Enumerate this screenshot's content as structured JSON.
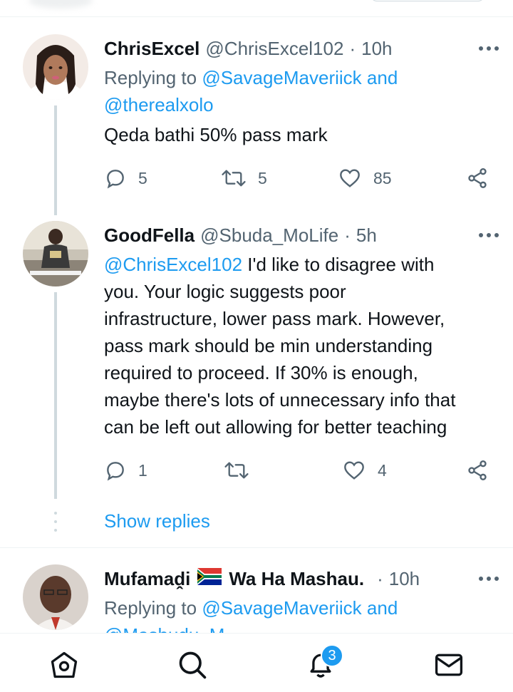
{
  "tweets": [
    {
      "name": "ChrisExcel",
      "handle": "@ChrisExcel102",
      "time": "10h",
      "replying_prefix": "Replying to",
      "replying_line1": "@SavageMaveriick and",
      "replying_line2": "@therealxolo",
      "text": "Qeda bathi 50% pass mark",
      "replies": "5",
      "retweets": "5",
      "likes": "85"
    },
    {
      "name": "GoodFella",
      "handle": "@Sbuda_MoLife",
      "time": "5h",
      "mention": "@ChrisExcel102",
      "text_line1": " I'd like to disagree with",
      "text_lines": [
        "you. Your logic suggests poor",
        "infrastructure, lower pass mark. However,",
        "pass mark should be min understanding",
        "required to proceed. If 30% is enough,",
        "maybe there's lots of unnecessary info that",
        "can be left out allowing for better teaching"
      ],
      "replies": "1",
      "retweets": "",
      "likes": "4"
    },
    {
      "name_part1": "Mufamaḓi",
      "flag": "South Africa flag",
      "name_part2": "Wa Ha Mashau.",
      "time": "10h",
      "replying_prefix": "Replying to",
      "replying_line1": "@SavageMaveriick and",
      "replying_line2": "@Mashudu_M..."
    }
  ],
  "show_replies": "Show replies",
  "nav": {
    "home": "home-icon",
    "search": "search-icon",
    "notifications": "bell-icon",
    "notifications_badge": "3",
    "messages": "mail-icon"
  },
  "colors": {
    "accent": "#1d9bf0",
    "text": "#0f1419",
    "secondary": "#536471",
    "line": "#cfd9de"
  }
}
